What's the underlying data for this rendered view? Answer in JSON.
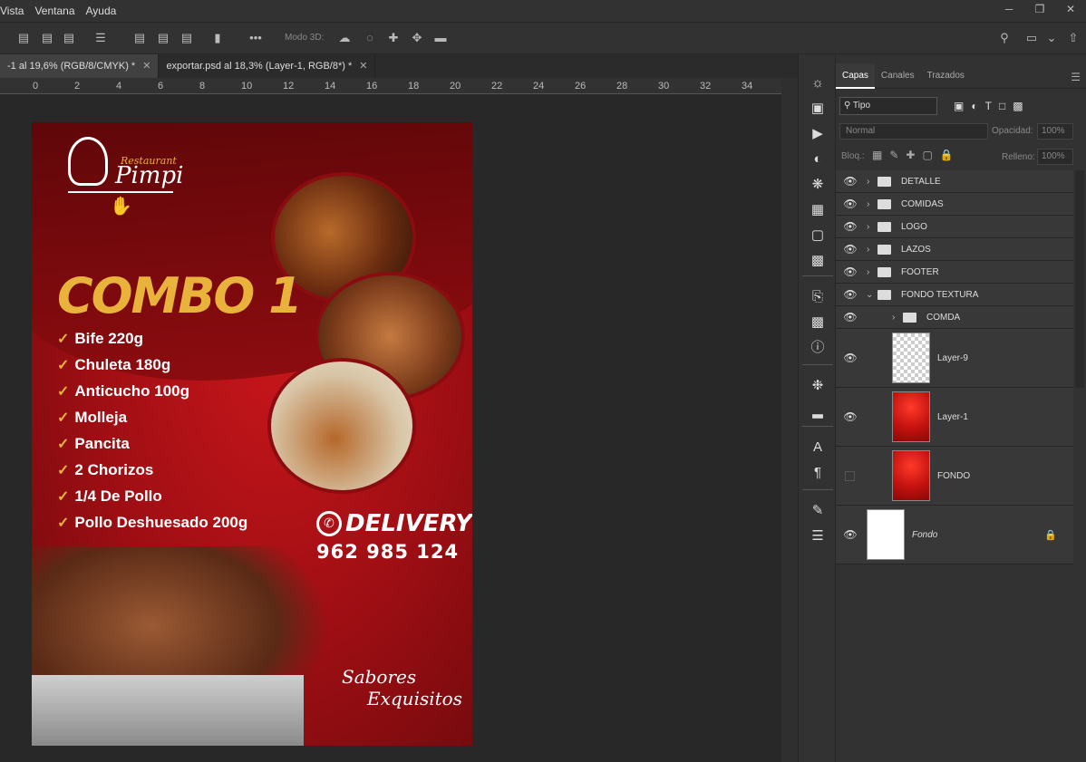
{
  "menu": {
    "items": [
      "Vista",
      "Ventana",
      "Ayuda"
    ]
  },
  "options": {
    "mode3d_label": "Modo 3D:"
  },
  "tabs": [
    {
      "label": "-1 al 19,6% (RGB/8/CMYK) *",
      "active": true
    },
    {
      "label": "exportar.psd al 18,3% (Layer-1, RGB/8*) *",
      "active": false
    }
  ],
  "ruler": {
    "labels": [
      "0",
      "2",
      "4",
      "6",
      "8",
      "10",
      "12",
      "14",
      "16",
      "18",
      "20",
      "22",
      "24",
      "26",
      "28",
      "30",
      "32",
      "34"
    ]
  },
  "poster": {
    "logo_small": "Restaurant",
    "logo_name": "Pimpi",
    "title": "COMBO 1",
    "items": [
      "Bife 220g",
      "Chuleta 180g",
      "Anticucho 100g",
      "Molleja",
      "Pancita",
      "2 Chorizos",
      "1/4 De Pollo",
      "Pollo Deshuesado 200g"
    ],
    "delivery": "DELIVERY",
    "phone": "962 985 124",
    "slogan_1": "Sabores",
    "slogan_2": "Exquisitos"
  },
  "panel": {
    "tabs": [
      "Capas",
      "Canales",
      "Trazados"
    ],
    "filter_label": "Tipo",
    "blend_mode": "Normal",
    "opacity_label": "Opacidad:",
    "opacity_value": "100%",
    "lock_label": "Bloq.:",
    "fill_label": "Relleno:",
    "fill_value": "100%",
    "layers": [
      {
        "name": "DETALLE",
        "type": "group"
      },
      {
        "name": "COMIDAS",
        "type": "group"
      },
      {
        "name": "LOGO",
        "type": "group"
      },
      {
        "name": "LAZOS",
        "type": "group"
      },
      {
        "name": "FOOTER",
        "type": "group"
      },
      {
        "name": "FONDO TEXTURA",
        "type": "group-open"
      },
      {
        "name": "COMDA",
        "type": "subgroup"
      },
      {
        "name": "Layer-9",
        "type": "layer"
      },
      {
        "name": "Layer-1",
        "type": "layer"
      },
      {
        "name": "FONDO",
        "type": "layer"
      },
      {
        "name": "Fondo",
        "type": "background"
      }
    ]
  }
}
